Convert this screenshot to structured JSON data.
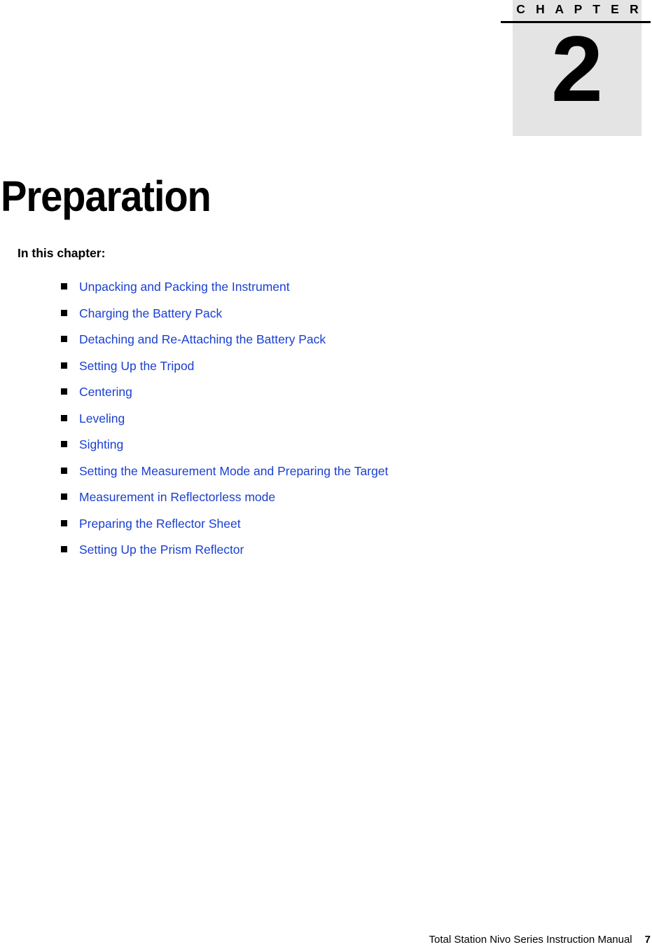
{
  "chapter_marker": {
    "label": "C H A P T E R",
    "number": "2",
    "box_color": "#e4e4e4",
    "rule_color": "#000000"
  },
  "page_title": "Preparation",
  "section_heading": "In this chapter:",
  "link_color": "#1a3fd0",
  "bullet_icon": "black-square-bullet",
  "chapter_list": [
    {
      "label": "Unpacking and Packing the Instrument"
    },
    {
      "label": "Charging the Battery Pack"
    },
    {
      "label": "Detaching and Re-Attaching the Battery Pack"
    },
    {
      "label": "Setting Up the Tripod"
    },
    {
      "label": "Centering"
    },
    {
      "label": "Leveling"
    },
    {
      "label": "Sighting"
    },
    {
      "label": "Setting the Measurement Mode and Preparing the Target"
    },
    {
      "label": "Measurement in Reflectorless mode"
    },
    {
      "label": "Preparing the Reflector Sheet"
    },
    {
      "label": "Setting Up the Prism Reflector"
    }
  ],
  "footer": {
    "text": "Total Station Nivo Series Instruction Manual",
    "page_number": "7"
  }
}
